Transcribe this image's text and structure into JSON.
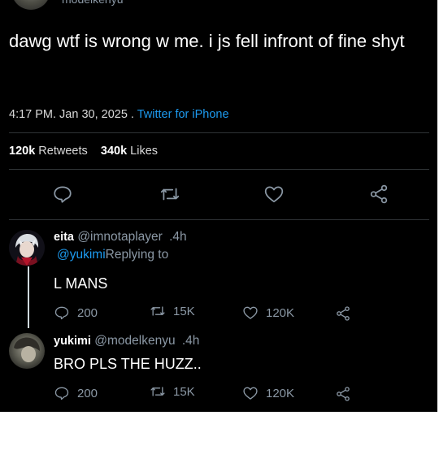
{
  "main_tweet": {
    "handle": "modelkenyu",
    "text": "dawg wtf is wrong w me. i js fell infront of fine shyt",
    "timestamp": "4:17 PM. Jan 30, 2025",
    "separator": " . ",
    "source": "Twitter for iPhone",
    "retweets_count": "120k",
    "retweets_label": "Retweets",
    "likes_count": "340k",
    "likes_label": "Likes"
  },
  "action_icons": [
    "comment-icon",
    "retweet-icon",
    "heart-icon",
    "share-icon"
  ],
  "replies": [
    {
      "name": "eita",
      "handle": "@imnotaplayer",
      "time": ".4h",
      "mention": "@yukimi",
      "replying_to": "Replying to",
      "text": "L MANS",
      "comments": "200",
      "retweets": "15K",
      "likes": "120K"
    },
    {
      "name": "yukimi",
      "handle": "@modelkenyu",
      "time": ".4h",
      "text": "BRO PLS THE HUZZ..",
      "comments": "200",
      "retweets": "15K",
      "likes": "120K"
    }
  ],
  "colors": {
    "background": "#000000",
    "link": "#1d9bf0",
    "muted": "#8b98a5",
    "divider": "#2f3336"
  }
}
